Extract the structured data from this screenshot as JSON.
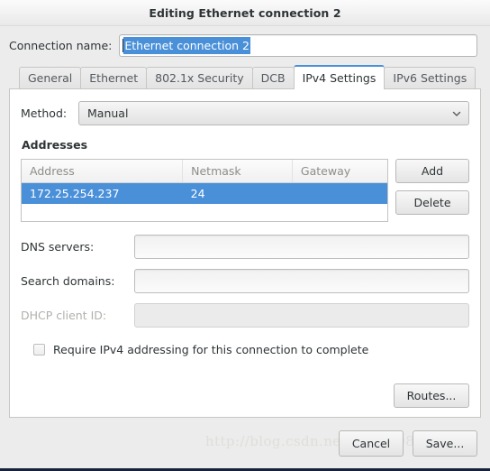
{
  "window": {
    "title": "Editing Ethernet connection 2"
  },
  "connection_name": {
    "label": "Connection name:",
    "value": "Ethernet connection 2",
    "selected": true
  },
  "tabs": [
    {
      "label": "General",
      "active": false
    },
    {
      "label": "Ethernet",
      "active": false
    },
    {
      "label": "802.1x Security",
      "active": false
    },
    {
      "label": "DCB",
      "active": false
    },
    {
      "label": "IPv4 Settings",
      "active": true
    },
    {
      "label": "IPv6 Settings",
      "active": false
    }
  ],
  "method": {
    "label": "Method:",
    "value": "Manual",
    "icon": "chevron-down-icon"
  },
  "addresses": {
    "title": "Addresses",
    "columns": [
      "Address",
      "Netmask",
      "Gateway"
    ],
    "rows": [
      {
        "address": "172.25.254.237",
        "netmask": "24",
        "gateway": "",
        "selected": true
      },
      {
        "address": "",
        "netmask": "",
        "gateway": "",
        "selected": false
      }
    ],
    "add_label": "Add",
    "delete_label": "Delete"
  },
  "fields": {
    "dns_label": "DNS servers:",
    "dns_value": "",
    "search_label": "Search domains:",
    "search_value": "",
    "dhcp_label": "DHCP client ID:",
    "dhcp_value": "",
    "dhcp_disabled": true
  },
  "require_ipv4": {
    "label": "Require IPv4 addressing for this connection to complete",
    "checked": false
  },
  "routes": {
    "label": "Routes..."
  },
  "actions": {
    "cancel_label": "Cancel",
    "save_label": "Save..."
  },
  "watermark": {
    "text": "http://blog.csdn.net/u010308833"
  },
  "colors": {
    "selection_blue": "#4a90d9",
    "accent_tab": "#4a90d9",
    "dialog_bg": "#ececec",
    "panel_bg": "#ffffff",
    "bottom_strip": "#16213a"
  }
}
